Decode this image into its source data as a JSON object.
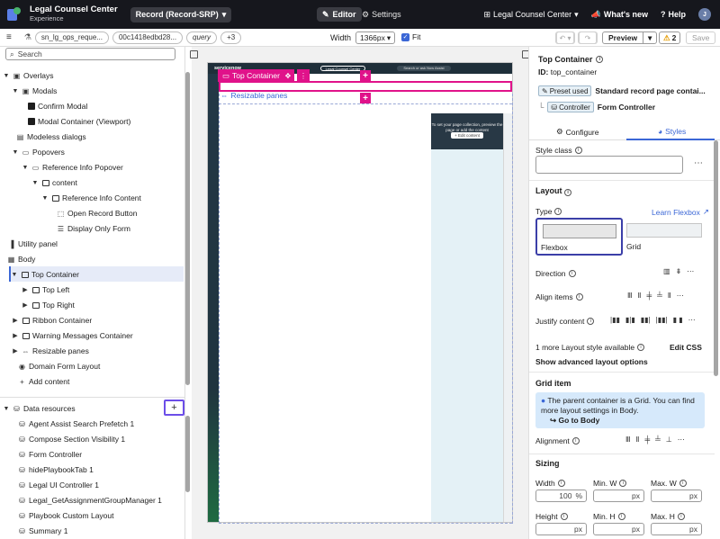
{
  "topbar": {
    "app_title": "Legal Counsel Center",
    "app_subtitle": "Experience",
    "record_label": "Record (Record-SRP)",
    "editor_label": "Editor",
    "settings_label": "Settings",
    "app_menu_label": "Legal Counsel Center",
    "whats_new_label": "What's new",
    "help_label": "Help",
    "user_initial": "J"
  },
  "toolbar": {
    "chips": [
      "sn_lg_ops_reque...",
      "00c1418edbd28...",
      "query",
      "+3"
    ],
    "width_label": "Width",
    "width_value": "1366px",
    "fit_label": "Fit",
    "preview_label": "Preview",
    "warnings_count": "2",
    "save_label": "Save"
  },
  "left_panel": {
    "search_placeholder": "Search",
    "tree": [
      {
        "label": "Overlays"
      },
      {
        "label": "Modals"
      },
      {
        "label": "Confirm Modal"
      },
      {
        "label": "Modal Container (Viewport)"
      },
      {
        "label": "Modeless dialogs"
      },
      {
        "label": "Popovers"
      },
      {
        "label": "Reference Info Popover"
      },
      {
        "label": "content"
      },
      {
        "label": "Reference Info Content"
      },
      {
        "label": "Open Record Button"
      },
      {
        "label": "Display Only Form"
      },
      {
        "label": "Utility panel"
      },
      {
        "label": "Body"
      },
      {
        "label": "Top Container"
      },
      {
        "label": "Top Left"
      },
      {
        "label": "Top Right"
      },
      {
        "label": "Ribbon Container"
      },
      {
        "label": "Warning Messages Container"
      },
      {
        "label": "Resizable panes"
      },
      {
        "label": "Domain Form Layout"
      }
    ],
    "add_content_label": "Add content",
    "data_resources_label": "Data resources",
    "data_resources": [
      "Agent Assist Search Prefetch 1",
      "Compose Section Visibility 1",
      "Form Controller",
      "hidePlaybookTab 1",
      "Legal UI Controller 1",
      "Legal_GetAssignmentGroupManager 1",
      "Playbook Custom Layout",
      "Summary 1"
    ]
  },
  "canvas": {
    "top_container_label": "Top Container",
    "resizable_panes_label": "Resizable panes",
    "preview_logo": "servicenow",
    "preview_app": "Legal Counsel Center",
    "preview_search": "Search or ask Now Assist",
    "preview_msg": "To set your page collection, preview the page or add the content",
    "preview_edit": "+ Edit content"
  },
  "right_panel": {
    "title": "Top Container",
    "id_label": "ID:",
    "id_value": "top_container",
    "preset_tag": "Preset used",
    "preset_value": "Standard record page contai...",
    "controller_tag": "Controller",
    "controller_value": "Form Controller",
    "tab_configure": "Configure",
    "tab_styles": "Styles",
    "style_class_label": "Style class",
    "layout_label": "Layout",
    "type_label": "Type",
    "learn_flexbox": "Learn Flexbox",
    "flexbox_label": "Flexbox",
    "grid_label": "Grid",
    "direction_label": "Direction",
    "align_items_label": "Align items",
    "justify_content_label": "Justify content",
    "more_layout_label": "1 more Layout style available",
    "edit_css_label": "Edit CSS",
    "show_advanced_label": "Show advanced layout options",
    "grid_item_label": "Grid item",
    "notice_text": "The parent container is a Grid. You can find more layout settings in Body.",
    "go_to_body_label": "Go to Body",
    "alignment_label": "Alignment",
    "sizing_label": "Sizing",
    "width_label": "Width",
    "width_value": "100",
    "width_unit": "%",
    "min_w_label": "Min. W",
    "max_w_label": "Max. W",
    "height_label": "Height",
    "min_h_label": "Min. H",
    "max_h_label": "Max. H",
    "px_unit": "px"
  }
}
